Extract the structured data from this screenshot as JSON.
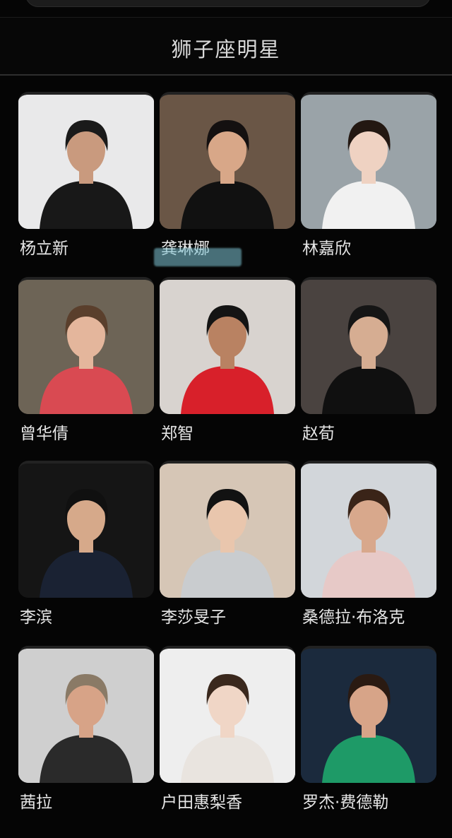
{
  "header": {
    "title": "狮子座明星"
  },
  "celebrities": [
    {
      "name": "杨立新",
      "bg": "#e9e9ea",
      "skin": "#c99a7e",
      "hair": "#1a1a1a",
      "clothes": "#181818"
    },
    {
      "name": "龚琳娜",
      "bg": "#6a5646",
      "skin": "#d8a788",
      "hair": "#141010",
      "clothes": "#111111"
    },
    {
      "name": "林嘉欣",
      "bg": "#9aa3a8",
      "skin": "#efd2c2",
      "hair": "#231812",
      "clothes": "#f1f1f1"
    },
    {
      "name": "曾华倩",
      "bg": "#6d6456",
      "skin": "#e4b69c",
      "hair": "#5a3f2c",
      "clothes": "#d94a52"
    },
    {
      "name": "郑智",
      "bg": "#d8d3cf",
      "skin": "#b98262",
      "hair": "#141414",
      "clothes": "#d8202a"
    },
    {
      "name": "赵荀",
      "bg": "#4a4340",
      "skin": "#d6ad92",
      "hair": "#151515",
      "clothes": "#101010"
    },
    {
      "name": "李滨",
      "bg": "#151515",
      "skin": "#d6a98a",
      "hair": "#101010",
      "clothes": "#1a2233"
    },
    {
      "name": "李莎旻子",
      "bg": "#d6c6b6",
      "skin": "#e9c6ad",
      "hair": "#121212",
      "clothes": "#c9cccf"
    },
    {
      "name": "桑德拉·布洛克",
      "bg": "#d2d6da",
      "skin": "#d8a88c",
      "hair": "#3a2418",
      "clothes": "#e7c9c7"
    },
    {
      "name": "茜拉",
      "bg": "#cfcfcf",
      "skin": "#d7a387",
      "hair": "#8a7a66",
      "clothes": "#2a2a2a"
    },
    {
      "name": "户田惠梨香",
      "bg": "#eeeeee",
      "skin": "#f0d6c6",
      "hair": "#3a281d",
      "clothes": "#e9e4df"
    },
    {
      "name": "罗杰·费德勒",
      "bg": "#1b2a3d",
      "skin": "#d7a488",
      "hair": "#2a1a12",
      "clothes": "#1e9a67"
    }
  ],
  "highlight": {
    "color": "#7fc7d6"
  }
}
